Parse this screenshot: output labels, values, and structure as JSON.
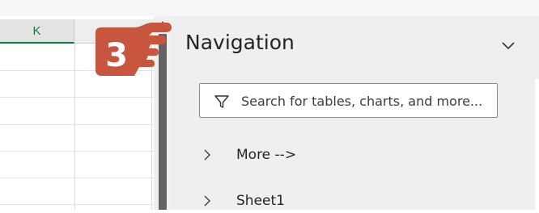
{
  "spreadsheet": {
    "column_header": "K"
  },
  "navigation_pane": {
    "title": "Navigation",
    "search": {
      "placeholder": "Search for tables, charts, and more..."
    },
    "items": [
      {
        "label": "More -->"
      },
      {
        "label": "Sheet1"
      }
    ]
  },
  "annotation": {
    "step_number": "3",
    "color": "#c8553d"
  },
  "colors": {
    "accent": "#127a3e",
    "pane_background": "#efefef"
  },
  "icons": {
    "search": "filter-icon",
    "collapse": "chevron-down-icon",
    "expand": "chevron-right-icon"
  }
}
